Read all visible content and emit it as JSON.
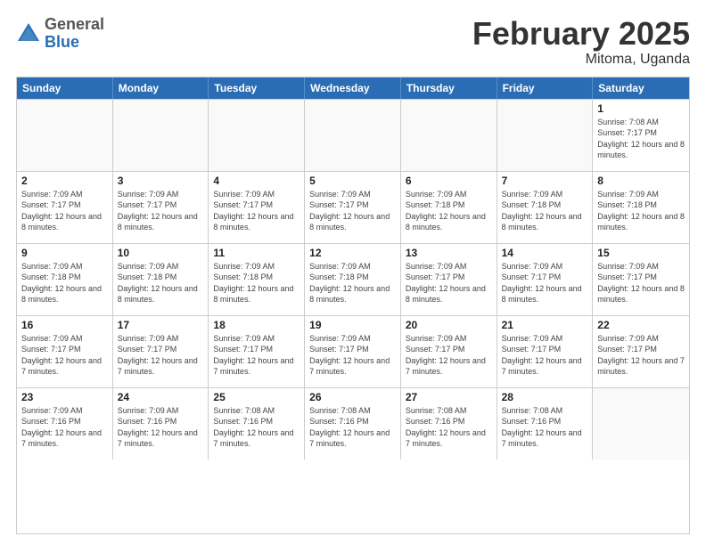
{
  "logo": {
    "general": "General",
    "blue": "Blue"
  },
  "header": {
    "month": "February 2025",
    "location": "Mitoma, Uganda"
  },
  "days_of_week": [
    "Sunday",
    "Monday",
    "Tuesday",
    "Wednesday",
    "Thursday",
    "Friday",
    "Saturday"
  ],
  "weeks": [
    [
      {
        "day": "",
        "info": ""
      },
      {
        "day": "",
        "info": ""
      },
      {
        "day": "",
        "info": ""
      },
      {
        "day": "",
        "info": ""
      },
      {
        "day": "",
        "info": ""
      },
      {
        "day": "",
        "info": ""
      },
      {
        "day": "1",
        "info": "Sunrise: 7:08 AM\nSunset: 7:17 PM\nDaylight: 12 hours and 8 minutes."
      }
    ],
    [
      {
        "day": "2",
        "info": "Sunrise: 7:09 AM\nSunset: 7:17 PM\nDaylight: 12 hours and 8 minutes."
      },
      {
        "day": "3",
        "info": "Sunrise: 7:09 AM\nSunset: 7:17 PM\nDaylight: 12 hours and 8 minutes."
      },
      {
        "day": "4",
        "info": "Sunrise: 7:09 AM\nSunset: 7:17 PM\nDaylight: 12 hours and 8 minutes."
      },
      {
        "day": "5",
        "info": "Sunrise: 7:09 AM\nSunset: 7:17 PM\nDaylight: 12 hours and 8 minutes."
      },
      {
        "day": "6",
        "info": "Sunrise: 7:09 AM\nSunset: 7:18 PM\nDaylight: 12 hours and 8 minutes."
      },
      {
        "day": "7",
        "info": "Sunrise: 7:09 AM\nSunset: 7:18 PM\nDaylight: 12 hours and 8 minutes."
      },
      {
        "day": "8",
        "info": "Sunrise: 7:09 AM\nSunset: 7:18 PM\nDaylight: 12 hours and 8 minutes."
      }
    ],
    [
      {
        "day": "9",
        "info": "Sunrise: 7:09 AM\nSunset: 7:18 PM\nDaylight: 12 hours and 8 minutes."
      },
      {
        "day": "10",
        "info": "Sunrise: 7:09 AM\nSunset: 7:18 PM\nDaylight: 12 hours and 8 minutes."
      },
      {
        "day": "11",
        "info": "Sunrise: 7:09 AM\nSunset: 7:18 PM\nDaylight: 12 hours and 8 minutes."
      },
      {
        "day": "12",
        "info": "Sunrise: 7:09 AM\nSunset: 7:18 PM\nDaylight: 12 hours and 8 minutes."
      },
      {
        "day": "13",
        "info": "Sunrise: 7:09 AM\nSunset: 7:17 PM\nDaylight: 12 hours and 8 minutes."
      },
      {
        "day": "14",
        "info": "Sunrise: 7:09 AM\nSunset: 7:17 PM\nDaylight: 12 hours and 8 minutes."
      },
      {
        "day": "15",
        "info": "Sunrise: 7:09 AM\nSunset: 7:17 PM\nDaylight: 12 hours and 8 minutes."
      }
    ],
    [
      {
        "day": "16",
        "info": "Sunrise: 7:09 AM\nSunset: 7:17 PM\nDaylight: 12 hours and 7 minutes."
      },
      {
        "day": "17",
        "info": "Sunrise: 7:09 AM\nSunset: 7:17 PM\nDaylight: 12 hours and 7 minutes."
      },
      {
        "day": "18",
        "info": "Sunrise: 7:09 AM\nSunset: 7:17 PM\nDaylight: 12 hours and 7 minutes."
      },
      {
        "day": "19",
        "info": "Sunrise: 7:09 AM\nSunset: 7:17 PM\nDaylight: 12 hours and 7 minutes."
      },
      {
        "day": "20",
        "info": "Sunrise: 7:09 AM\nSunset: 7:17 PM\nDaylight: 12 hours and 7 minutes."
      },
      {
        "day": "21",
        "info": "Sunrise: 7:09 AM\nSunset: 7:17 PM\nDaylight: 12 hours and 7 minutes."
      },
      {
        "day": "22",
        "info": "Sunrise: 7:09 AM\nSunset: 7:17 PM\nDaylight: 12 hours and 7 minutes."
      }
    ],
    [
      {
        "day": "23",
        "info": "Sunrise: 7:09 AM\nSunset: 7:16 PM\nDaylight: 12 hours and 7 minutes."
      },
      {
        "day": "24",
        "info": "Sunrise: 7:09 AM\nSunset: 7:16 PM\nDaylight: 12 hours and 7 minutes."
      },
      {
        "day": "25",
        "info": "Sunrise: 7:08 AM\nSunset: 7:16 PM\nDaylight: 12 hours and 7 minutes."
      },
      {
        "day": "26",
        "info": "Sunrise: 7:08 AM\nSunset: 7:16 PM\nDaylight: 12 hours and 7 minutes."
      },
      {
        "day": "27",
        "info": "Sunrise: 7:08 AM\nSunset: 7:16 PM\nDaylight: 12 hours and 7 minutes."
      },
      {
        "day": "28",
        "info": "Sunrise: 7:08 AM\nSunset: 7:16 PM\nDaylight: 12 hours and 7 minutes."
      },
      {
        "day": "",
        "info": ""
      }
    ]
  ]
}
